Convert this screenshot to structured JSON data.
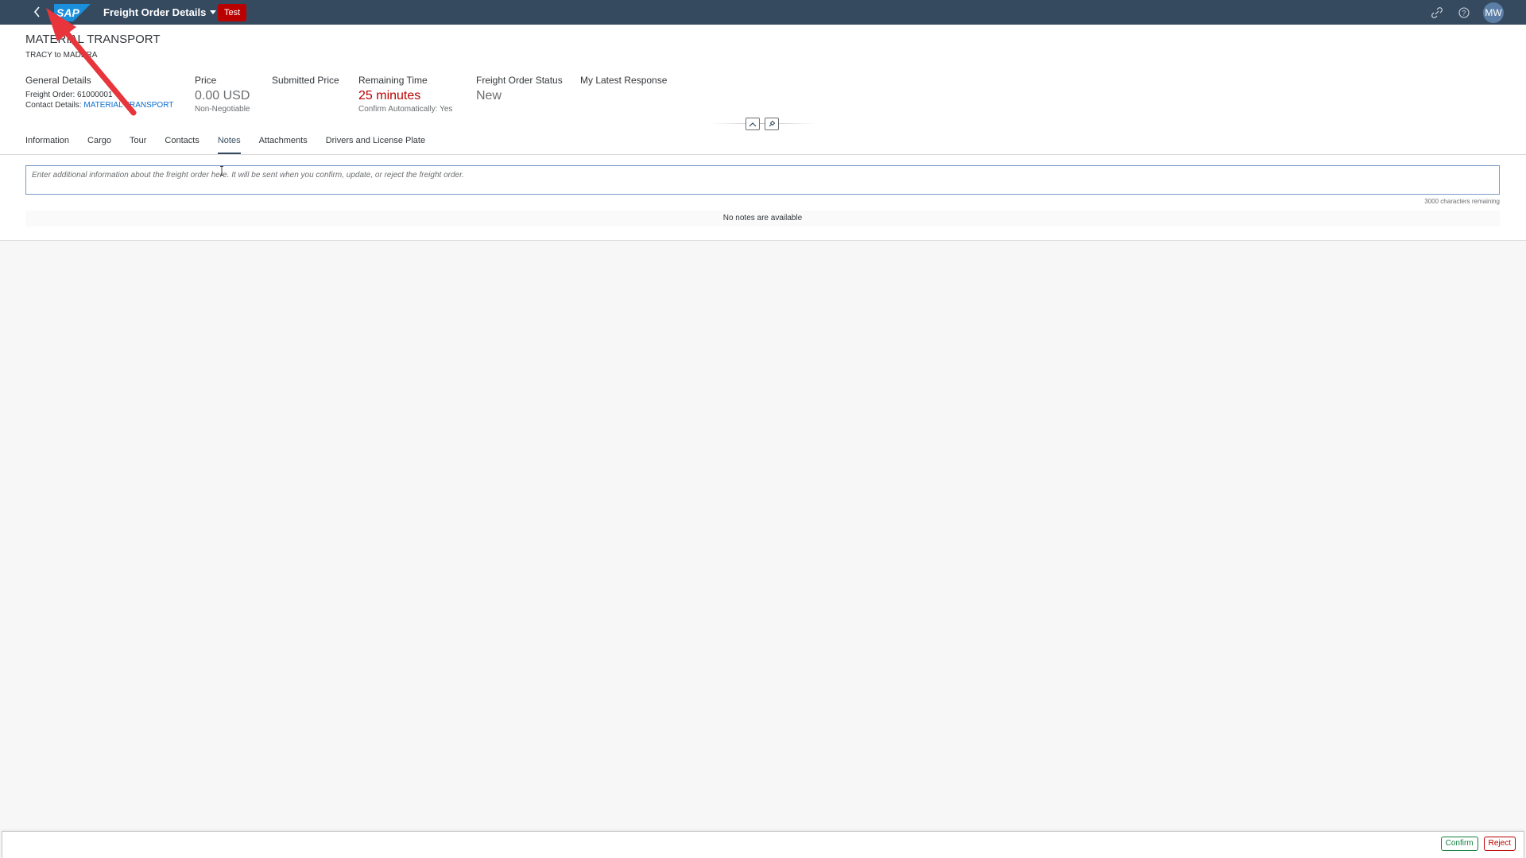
{
  "shell": {
    "app_title": "Freight Order Details",
    "env_badge": "Test",
    "avatar_initials": "MW",
    "icons": [
      "back-icon",
      "sap-logo",
      "chevron-down-icon",
      "link-icon",
      "help-icon"
    ]
  },
  "header": {
    "title": "MATERIAL TRANSPORT",
    "subtitle": "TRACY to MADERA",
    "general_details": {
      "label": "General Details",
      "freight_order_label": "Freight Order:",
      "freight_order_value": "61000001",
      "contact_label": "Contact Details:",
      "contact_value": "MATERIAL TRANSPORT"
    },
    "price": {
      "label": "Price",
      "value": "0.00 USD",
      "sub": "Non-Negotiable"
    },
    "submitted_price": {
      "label": "Submitted Price"
    },
    "remaining_time": {
      "label": "Remaining Time",
      "value": "25 minutes",
      "sub": "Confirm Automatically: Yes"
    },
    "status": {
      "label": "Freight Order Status",
      "value": "New"
    },
    "latest_response": {
      "label": "My Latest Response"
    }
  },
  "tabs": [
    {
      "label": "Information"
    },
    {
      "label": "Cargo"
    },
    {
      "label": "Tour"
    },
    {
      "label": "Contacts"
    },
    {
      "label": "Notes",
      "active": true
    },
    {
      "label": "Attachments"
    },
    {
      "label": "Drivers and License Plate"
    }
  ],
  "notes": {
    "placeholder": "Enter additional information about the freight order here. It will be sent when you confirm, update, or reject the freight order.",
    "chars_remaining": "3000 characters remaining",
    "empty_text": "No notes are available"
  },
  "footer": {
    "confirm_label": "Confirm",
    "reject_label": "Reject"
  },
  "colors": {
    "shell_bg": "#354a5f",
    "badge_red": "#bb0000",
    "link_blue": "#0a6ed1",
    "confirm_green": "#107e3e",
    "annotation_arrow": "#e8353b"
  }
}
